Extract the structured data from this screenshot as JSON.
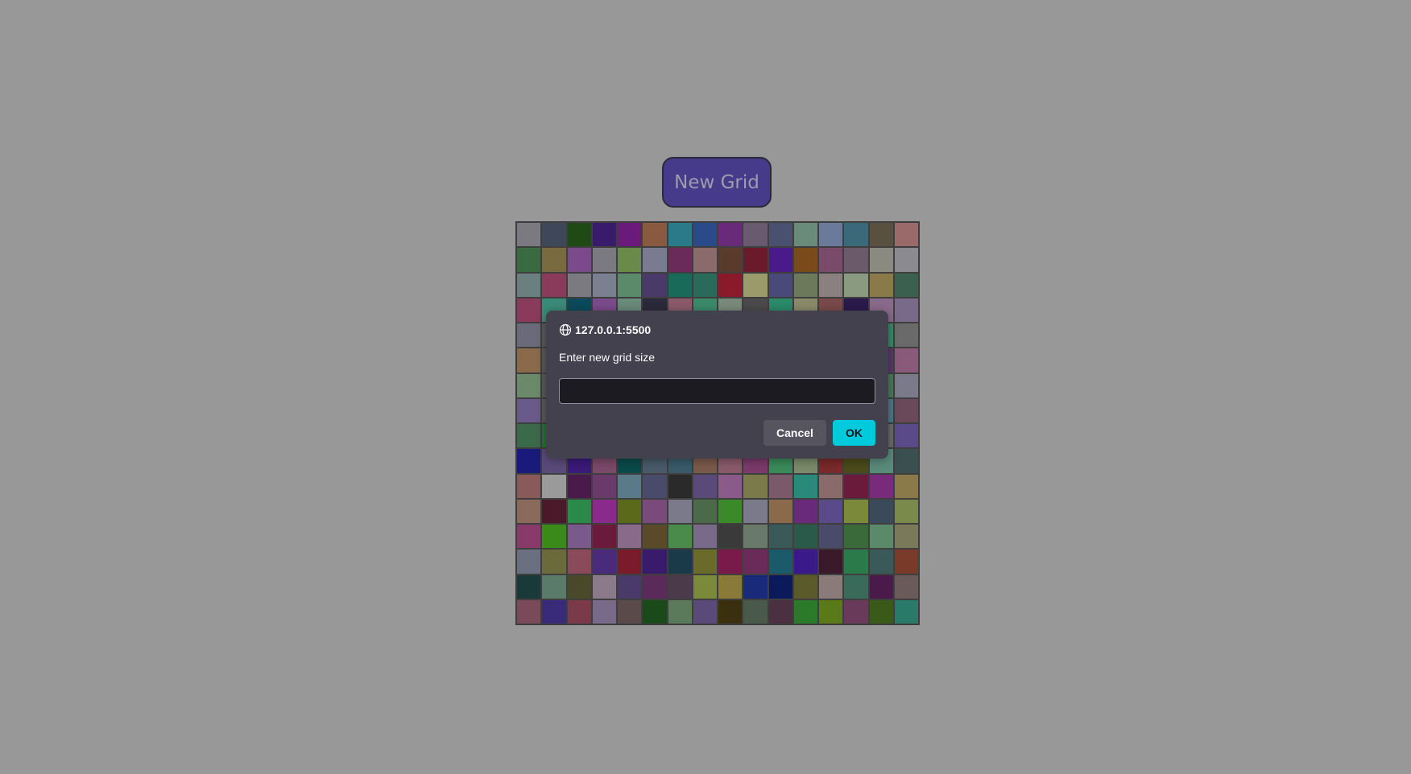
{
  "app": {
    "new_grid_label": "New Grid"
  },
  "grid": {
    "columns": 16,
    "rows": 16,
    "cells": [
      "#7a7a80",
      "#3f4858",
      "#1f4a16",
      "#3a1a6a",
      "#6a1a7a",
      "#8a5a40",
      "#2a7a8a",
      "#2a4a8a",
      "#6a2a7a",
      "#6a5a70",
      "#4a5070",
      "#6a8a7a",
      "#6a7a9a",
      "#3a6a7a",
      "#5a5040",
      "#9a6a6a",
      "#3a6a40",
      "#7a6a40",
      "#7a4a8a",
      "#7a7a80",
      "#6a8a4a",
      "#7a7a90",
      "#6a2a5a",
      "#8a6a6a",
      "#5a3a2a",
      "#6a1a2a",
      "#4a1a8a",
      "#7a4a1a",
      "#7a4a6a",
      "#6a5a6a",
      "#8a8a80",
      "#8a8a90",
      "#6a8080",
      "#8a3a5a",
      "#7a7a80",
      "#7a8090",
      "#5a8a6a",
      "#4a3a6a",
      "#1a6a5a",
      "#2a6a5a",
      "#8a1a2a",
      "#9a9a6a",
      "#4a4a7a",
      "#6a7a5a",
      "#8a8080",
      "#8a9a80",
      "#8a7a4a",
      "#3a6050",
      "#8a3a5a",
      "#3a8a7a",
      "#0a4a5a",
      "#7a4a8a",
      "#6a8a7a",
      "#2a2a3a",
      "#8a5a6a",
      "#3a8a6a",
      "#7a8a7a",
      "#4a4a4a",
      "#2a8a6a",
      "#8a8a6a",
      "#7a4a4a",
      "#2a1a4a",
      "#8a6a8a",
      "#7a6a8a",
      "#6a6a7a",
      "#5a5a5a",
      "#5a5a5a",
      "#5a5a5a",
      "#5a5a5a",
      "#5a5a5a",
      "#5a5a5a",
      "#5a5a5a",
      "#5a5a5a",
      "#5a5a5a",
      "#5a5a5a",
      "#5a5a5a",
      "#5a5a5a",
      "#3a8a6a",
      "#3a8a6a",
      "#6a6a6a",
      "#8a6a4a",
      "#5a5a5a",
      "#5a5a5a",
      "#5a5a5a",
      "#5a5a5a",
      "#5a5a5a",
      "#5a5a5a",
      "#5a5a5a",
      "#5a5a5a",
      "#5a5a5a",
      "#5a5a5a",
      "#5a5a5a",
      "#5a5a5a",
      "#5a3a6a",
      "#5a3a6a",
      "#8a5a7a",
      "#6a8a6a",
      "#5a5a5a",
      "#5a5a5a",
      "#5a5a5a",
      "#5a5a5a",
      "#5a5a5a",
      "#5a5a5a",
      "#5a5a5a",
      "#5a5a5a",
      "#5a5a5a",
      "#5a5a5a",
      "#5a5a5a",
      "#5a5a5a",
      "#4a7a5a",
      "#4a7a5a",
      "#7a7a8a",
      "#6a5a8a",
      "#5a5a5a",
      "#5a5a5a",
      "#5a5a5a",
      "#5a5a5a",
      "#5a5a5a",
      "#5a5a5a",
      "#5a5a5a",
      "#5a5a5a",
      "#5a5a5a",
      "#5a5a5a",
      "#5a5a5a",
      "#5a5a5a",
      "#4a7a8a",
      "#4a7a8a",
      "#6a4a5a",
      "#3a6a4a",
      "#1a7a2a",
      "#5a5a5a",
      "#5a5a5a",
      "#5a5a5a",
      "#5a5a5a",
      "#5a5a5a",
      "#5a5a5a",
      "#5a5a5a",
      "#5a5a5a",
      "#5a5a5a",
      "#5a5a5a",
      "#5a5a5a",
      "#6a6a6a",
      "#6a6a6a",
      "#5a4a8a",
      "#1a1a7a",
      "#5a4a7a",
      "#3a1a7a",
      "#7a4a6a",
      "#0a4a4a",
      "#4a5a6a",
      "#3a5a6a",
      "#7a5a4a",
      "#8a5a6a",
      "#7a3a6a",
      "#3a8a5a",
      "#7a8a6a",
      "#7a2a2a",
      "#4a4a1a",
      "#5a8a7a",
      "#3a5050",
      "#8a5a5a",
      "#9a9a9a",
      "#4a1a4a",
      "#6a3a6a",
      "#5a7a8a",
      "#4a4a6a",
      "#2a2a2a",
      "#5a4a7a",
      "#8a5a8a",
      "#7a7a4a",
      "#7a5a6a",
      "#2a8a7a",
      "#8a6a6a",
      "#6a1a3a",
      "#7a2a7a",
      "#8a7a4a",
      "#8a6a5a",
      "#4a1a2a",
      "#2a8a4a",
      "#8a2a8a",
      "#5a6a1a",
      "#7a4a7a",
      "#7a7a8a",
      "#4a6a4a",
      "#3a8a2a",
      "#7a7a8a",
      "#8a6a4a",
      "#6a2a7a",
      "#5a4a8a",
      "#7a8a3a",
      "#3a4a5a",
      "#7a8a4a",
      "#8a3a6a",
      "#3a8a1a",
      "#7a5a8a",
      "#6a1a3a",
      "#8a6a8a",
      "#5a4a2a",
      "#4a8a4a",
      "#7a6a8a",
      "#3a3a3a",
      "#6a7a6a",
      "#3a5a5a",
      "#2a5a4a",
      "#4a4a6a",
      "#3a6a3a",
      "#5a8a6a",
      "#7a7a5a",
      "#6a7080",
      "#6a6a3a",
      "#8a4a5a",
      "#4a2a7a",
      "#7a1a2a",
      "#3a1a6a",
      "#1a3a4a",
      "#6a6a2a",
      "#7a1a4a",
      "#6a2a5a",
      "#1a5a6a",
      "#3a1a8a",
      "#3a1a2a",
      "#2a7a4a",
      "#3a5a5a",
      "#7a3a2a",
      "#1a3a3a",
      "#5a7a6a",
      "#4a4a2a",
      "#8a7a8a",
      "#4a3a6a",
      "#5a2a5a",
      "#4a3a4a",
      "#7a8a3a",
      "#8a7a3a",
      "#1a2a7a",
      "#0a1a5a",
      "#5a5a2a",
      "#8a7a7a",
      "#3a6a5a",
      "#4a1a4a",
      "#6a5a5a",
      "#7a4a5a",
      "#3a2a7a",
      "#7a3a4a",
      "#7a6a8a",
      "#5a4a4a",
      "#1a4a1a",
      "#5a7a5a",
      "#5a4a7a",
      "#3a3010",
      "#4a5a4a",
      "#4a3040",
      "#2a7a2a",
      "#5a7a1a",
      "#6a3a5a",
      "#3a5a1a",
      "#2a7a6a"
    ]
  },
  "dialog": {
    "origin": "127.0.0.1:5500",
    "message": "Enter new grid size",
    "input_value": "",
    "cancel_label": "Cancel",
    "ok_label": "OK",
    "origin_icon": "globe-icon"
  },
  "colors": {
    "page_background": "#989898",
    "new_grid_button": "#463a8a",
    "dialog_background": "#42414d",
    "ok_accent": "#00cadb"
  }
}
